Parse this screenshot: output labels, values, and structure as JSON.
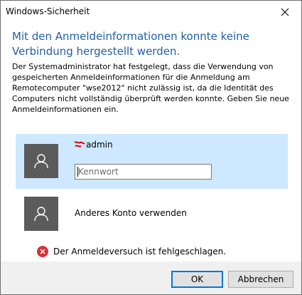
{
  "window": {
    "title": "Windows-Sicherheit"
  },
  "dialog": {
    "heading": "Mit den Anmeldeinformationen konnte keine Verbindung hergestellt werden.",
    "description": "Der Systemadministrator hat festgelegt, dass die Verwendung von gespeicherten Anmeldeinformationen für die Anmeldung am Remotecomputer \"wse2012\" nicht zulässig ist, da die Identität des Computers nicht vollständig überprüft werden konnte. Geben Sie neue Anmeldeinformationen ein."
  },
  "account_selected": {
    "username": "admin",
    "password_placeholder": "Kennwort",
    "password_value": ""
  },
  "account_other": {
    "label": "Anderes Konto verwenden"
  },
  "error": {
    "message": "Der Anmeldeversuch ist fehlgeschlagen."
  },
  "buttons": {
    "ok": "OK",
    "cancel": "Abbrechen"
  },
  "colors": {
    "heading": "#1f5fa6",
    "selected_tile": "#cde8ff",
    "avatar": "#5b5b5b",
    "error": "#d13438",
    "default_button_border": "#0078d7"
  },
  "icons": {
    "close": "close-icon",
    "avatar": "user-icon",
    "error": "error-icon",
    "user_mark": "redacted-mark-icon"
  }
}
